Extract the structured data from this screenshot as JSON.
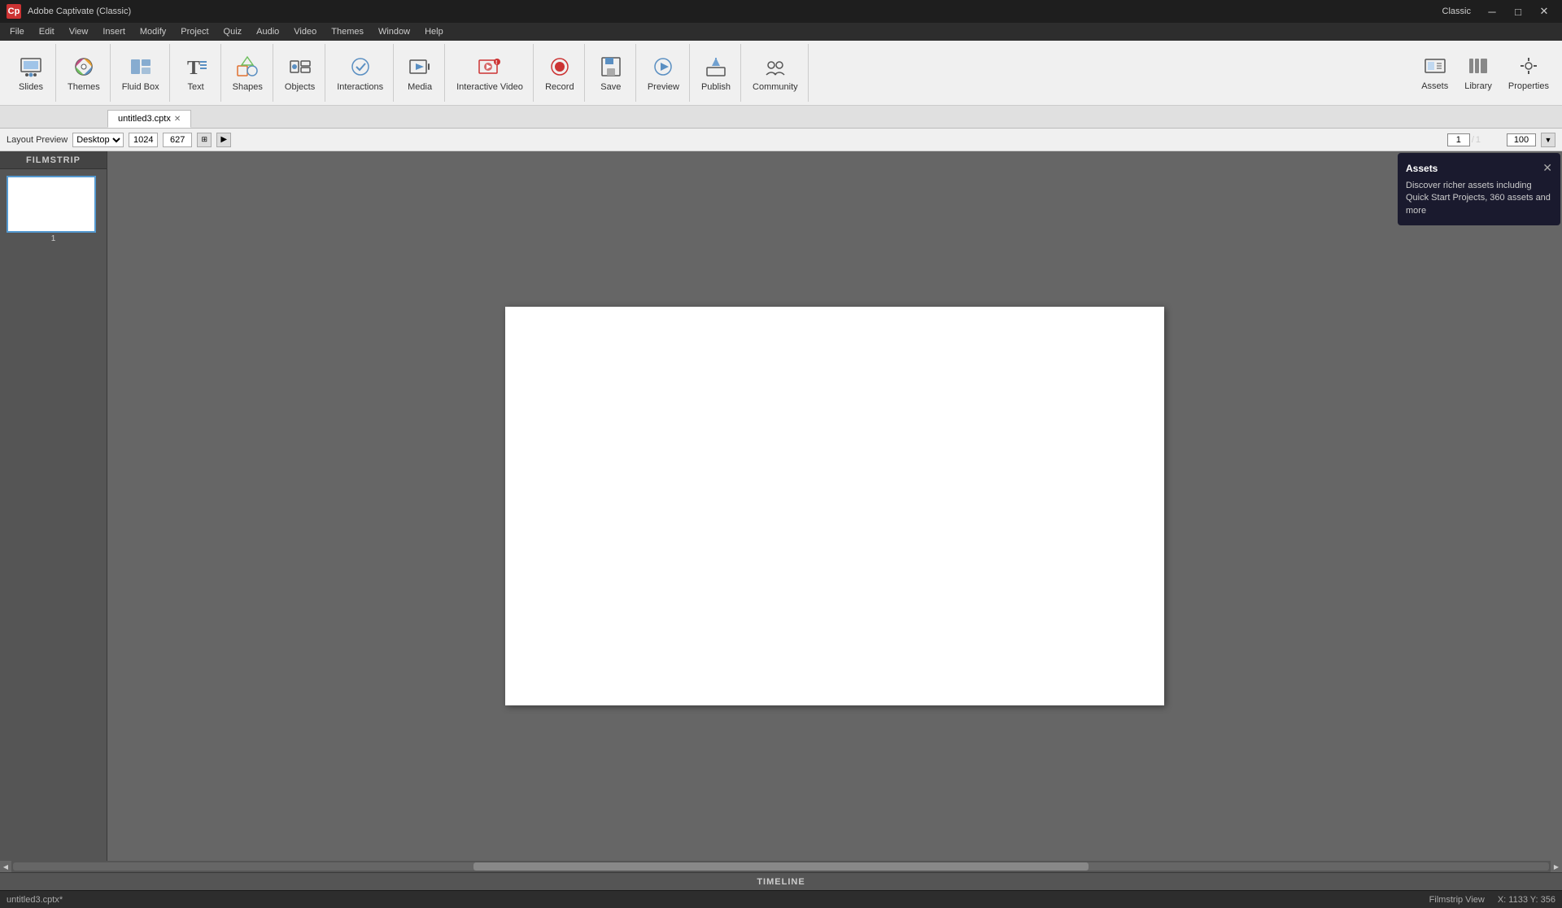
{
  "titlebar": {
    "logo": "Cp",
    "title": "Adobe Captivate (Classic)",
    "preset": "Classic",
    "minimize": "─",
    "maximize": "□",
    "close": "✕"
  },
  "menubar": {
    "items": [
      "File",
      "Edit",
      "View",
      "Insert",
      "Modify",
      "Project",
      "Quiz",
      "Audio",
      "Video",
      "Themes",
      "Window",
      "Help"
    ]
  },
  "toolbar": {
    "slides_label": "Slides",
    "themes_label": "Themes",
    "fluid_box_label": "Fluid Box",
    "text_label": "Text",
    "shapes_label": "Shapes",
    "objects_label": "Objects",
    "interactions_label": "Interactions",
    "media_label": "Media",
    "interactive_video_label": "Interactive Video",
    "record_label": "Record",
    "save_label": "Save",
    "preview_label": "Preview",
    "publish_label": "Publish",
    "community_label": "Community",
    "assets_label": "Assets",
    "library_label": "Library",
    "properties_label": "Properties"
  },
  "slide_toolbar": {
    "layout_preview": "Layout Preview",
    "desktop": "Desktop",
    "width": "1024",
    "height": "627",
    "page_current": "1",
    "page_total": "1",
    "zoom": "100"
  },
  "tab": {
    "filename": "untitled3.cptx",
    "close": "✕"
  },
  "filmstrip": {
    "label": "FILMSTRIP",
    "slide_number": "1"
  },
  "canvas": {
    "coord_x": "1133",
    "coord_y": "356",
    "width_indicator": "1024"
  },
  "assets_tooltip": {
    "title": "Assets",
    "close": "✕",
    "description": "Discover richer assets including Quick Start Projects, 360 assets and more"
  },
  "timeline": {
    "label": "TIMELINE"
  },
  "statusbar": {
    "filename": "untitled3.cptx*",
    "view": "Filmstrip View",
    "coordinates": "X: 1133 Y: 356"
  },
  "right_panel": {
    "tabs": [
      "Assets",
      "Library",
      "Properties"
    ]
  }
}
